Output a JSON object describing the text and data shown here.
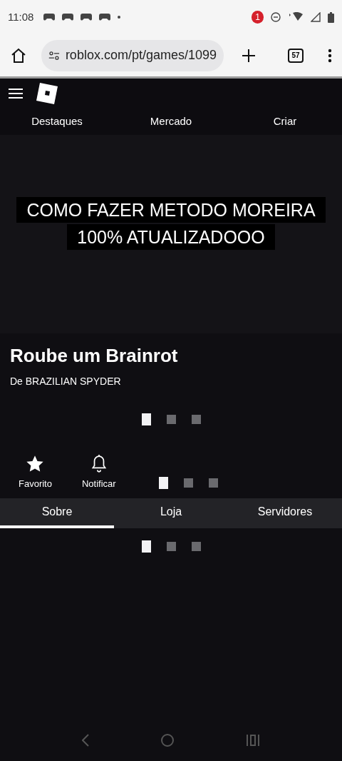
{
  "status_bar": {
    "time": "11:08",
    "notification_count": "1"
  },
  "browser": {
    "url": "roblox.com/pt/games/1099",
    "tab_count": "57"
  },
  "nav": {
    "items": [
      {
        "label": "Destaques"
      },
      {
        "label": "Mercado"
      },
      {
        "label": "Criar"
      }
    ]
  },
  "banner": {
    "caption_lines": [
      "COMO FAZER METODO MOREIRA",
      "100% ATUALIZADOOO"
    ]
  },
  "game": {
    "title": "Roube um Brainrot",
    "author": "De BRAZILIAN SPYDER"
  },
  "loaders": [
    {
      "dots": [
        {
          "selected": true
        },
        {
          "selected": false
        },
        {
          "selected": false
        }
      ]
    },
    {
      "dots": [
        {
          "selected": true
        },
        {
          "selected": false
        },
        {
          "selected": false
        }
      ]
    },
    {
      "dots": [
        {
          "selected": true
        },
        {
          "selected": false
        },
        {
          "selected": false
        }
      ]
    }
  ],
  "actions": [
    {
      "kind": "favorite",
      "label": "Favorito"
    },
    {
      "kind": "notify",
      "label": "Notificar"
    }
  ],
  "tabs": [
    {
      "label": "Sobre",
      "selected": true
    },
    {
      "label": "Loja",
      "selected": false
    },
    {
      "label": "Servidores",
      "selected": false
    }
  ]
}
